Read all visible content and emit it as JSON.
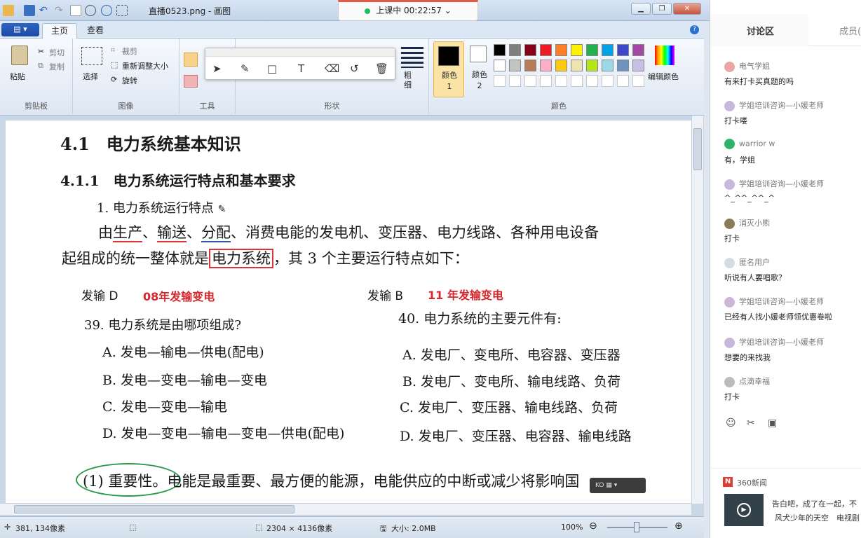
{
  "window": {
    "title": "直播0523.png - 画图",
    "live_status": "上课中 00:22:57"
  },
  "ribbon": {
    "file_label": "▤ ▾",
    "tabs": [
      "主页",
      "查看"
    ],
    "clipboard": {
      "paste": "粘贴",
      "cut": "剪切",
      "copy": "复制",
      "label": "剪贴板"
    },
    "image": {
      "select": "选择",
      "crop": "裁剪",
      "resize": "重新调整大小",
      "rotate": "旋转",
      "label": "图像"
    },
    "tools_label": "工具",
    "shapes": {
      "outline": "粗细",
      "label": "形状"
    },
    "colors": {
      "color1": "颜色 1",
      "color2": "颜色 2",
      "edit": "编辑颜色",
      "label": "颜色",
      "color1_value": "#000000",
      "color2_value": "#ffffff",
      "palette_row1": [
        "#000000",
        "#7f7f7f",
        "#880015",
        "#ed1c24",
        "#ff7f27",
        "#fff200",
        "#22b14c",
        "#00a2e8",
        "#3f48cc",
        "#a349a4"
      ],
      "palette_row2": [
        "#ffffff",
        "#c3c3c3",
        "#b97a57",
        "#ffaec9",
        "#ffc90e",
        "#efe4b0",
        "#b5e61d",
        "#99d9ea",
        "#7092be",
        "#c8bfe7"
      ]
    }
  },
  "document": {
    "h1": "4.1　电力系统基本知识",
    "h2": "4.1.1　电力系统运行特点和基本要求",
    "h3": "1. 电力系统运行特点",
    "para1_parts": [
      "由",
      "生产",
      "、",
      "输送",
      "、",
      "分配",
      "、消费电能的发电机、变压器、电力线路、各种用电设备"
    ],
    "para2_parts": [
      "起组成的统一整体就是",
      "电力系统",
      "，其 3 个主要运行特点如下："
    ],
    "q39": {
      "answer_label": "发输 D",
      "note": "08年发输变电",
      "question": "39. 电力系统是由哪项组成?",
      "options": [
        "A. 发电—输电—供电(配电)",
        "B. 发电—变电—输电—变电",
        "C. 发电—变电—输电",
        "D. 发电—变电—输电—变电—供电(配电)"
      ]
    },
    "q40": {
      "answer_label": "发输 B",
      "note": "11 年发输变电",
      "question": "40. 电力系统的主要元件有:",
      "options": [
        "A. 发电厂、变电所、电容器、变压器",
        "B. 发电厂、变电所、输电线路、负荷",
        "C. 发电厂、变压器、输电线路、负荷",
        "D. 发电厂、变压器、电容器、输电线路"
      ]
    },
    "para3_circled": "(1) 重要性",
    "para3_rest": "。电能是最重要、最方便的能源，电能供应的中断或减少将影响国"
  },
  "statusbar": {
    "cursor": "381, 134像素",
    "size": "2304 × 4136像素",
    "filesize": "大小: 2.0MB",
    "zoom": "100%"
  },
  "keyboard_indicator": "KO",
  "chat": {
    "tabs": [
      "讨论区",
      "成员("
    ],
    "messages": [
      {
        "user": "电气学姐",
        "text": "有来打卡买真题的吗",
        "avatar": "#e8a7a0"
      },
      {
        "user": "学姐培训咨询—小媛老师",
        "text": "打卡喽",
        "avatar": "#c9b7d9"
      },
      {
        "user": "warrior w",
        "text": "有，学姐",
        "avatar": "#2fb36b"
      },
      {
        "user": "学姐培训咨询—小媛老师",
        "text": "^_^^_^^_^",
        "avatar": "#c9b7d9"
      },
      {
        "user": "消灭小熊",
        "text": "打卡",
        "avatar": "#8a7a5a"
      },
      {
        "user": "匿名用户",
        "text": "听说有人要唱歌？",
        "avatar": "#d4dde0"
      },
      {
        "user": "学姐培训咨询—小媛老师",
        "text": "已经有人找小媛老师领优惠卷啦",
        "avatar": "#c9b7d9"
      },
      {
        "user": "学姐培训咨询—小媛老师",
        "text": "想要的来找我",
        "avatar": "#c9b7d9"
      },
      {
        "user": "点滴幸福",
        "text": "打卡",
        "avatar": "#bbbbbb"
      }
    ],
    "news_source": "360新闻",
    "news_line1": "告白吧，成了在一起，不",
    "news_line2": "风犬少年的天空　电视剧"
  }
}
